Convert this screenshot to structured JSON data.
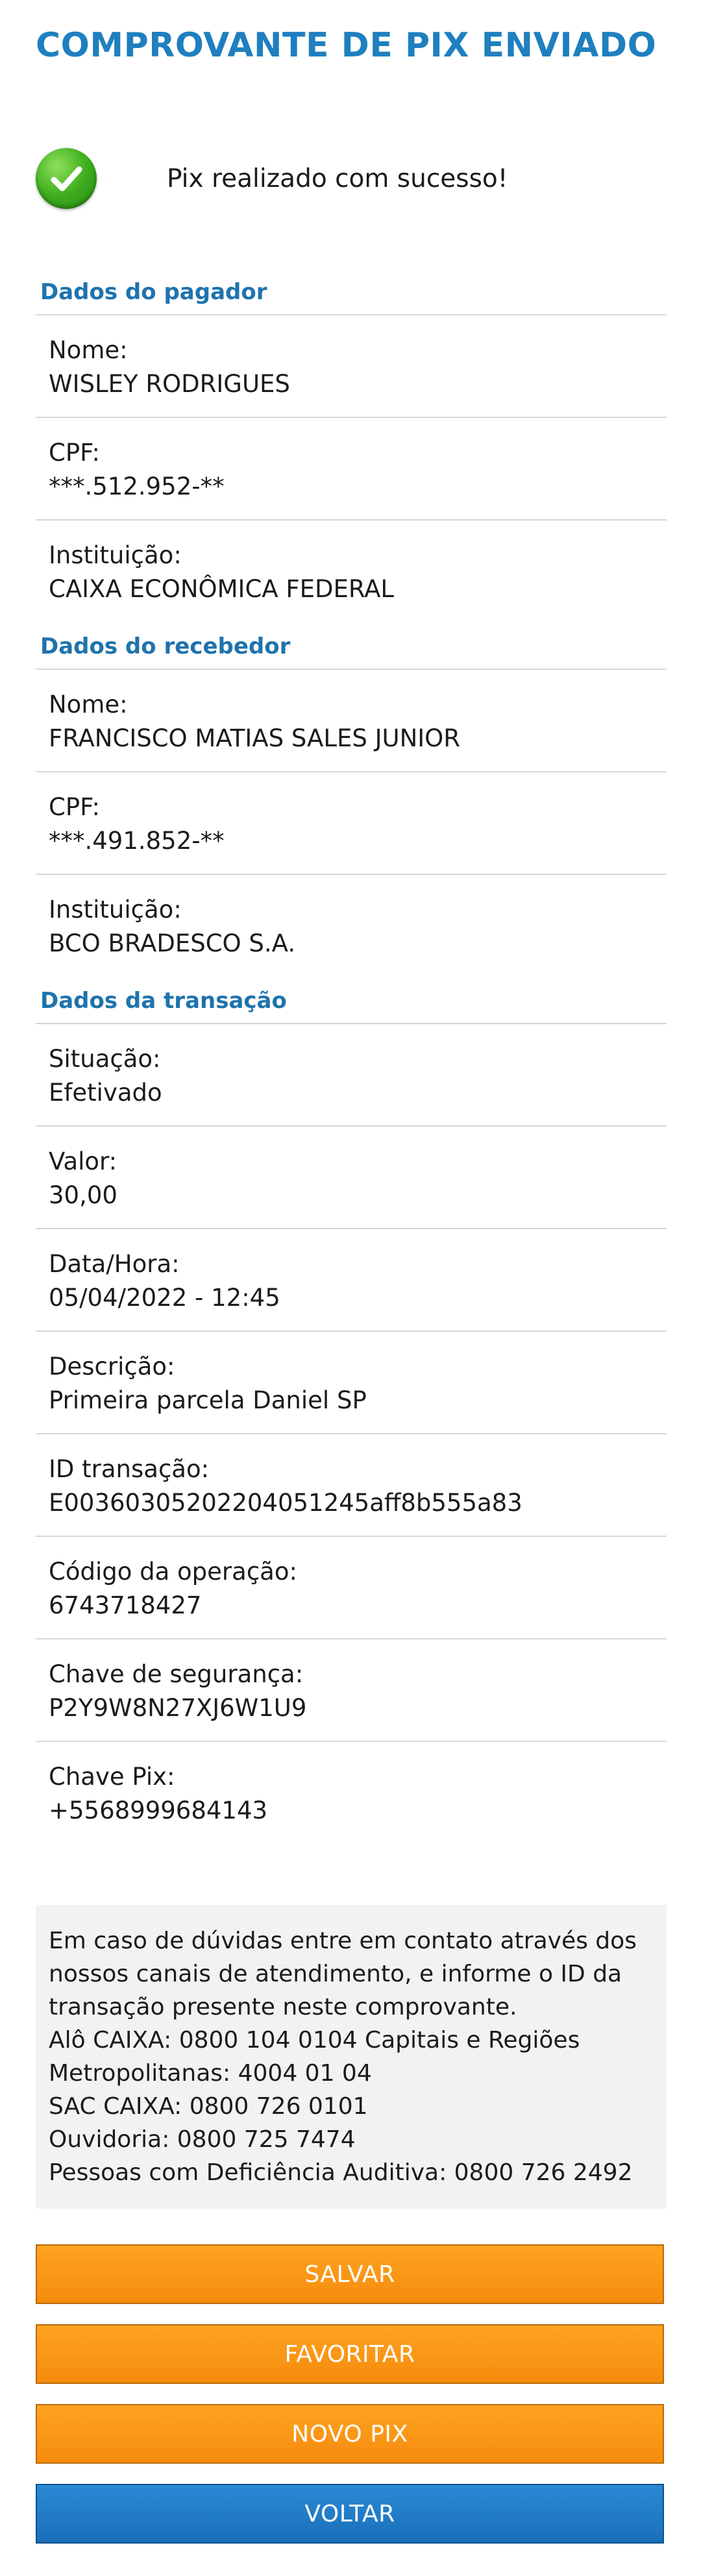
{
  "title": "COMPROVANTE DE PIX ENVIADO",
  "status": {
    "message": "Pix realizado com sucesso!",
    "icon": "check-circle-icon",
    "icon_color": "#3fae1f"
  },
  "accent_color": "#1f7fbf",
  "sections": {
    "pagador": {
      "title": "Dados do pagador",
      "fields": [
        {
          "label": "Nome:",
          "value": "WISLEY RODRIGUES"
        },
        {
          "label": "CPF:",
          "value": "***.512.952-**"
        },
        {
          "label": "Instituição:",
          "value": "CAIXA ECONÔMICA FEDERAL"
        }
      ]
    },
    "recebedor": {
      "title": "Dados do recebedor",
      "fields": [
        {
          "label": "Nome:",
          "value": "FRANCISCO MATIAS SALES JUNIOR"
        },
        {
          "label": "CPF:",
          "value": "***.491.852-**"
        },
        {
          "label": "Instituição:",
          "value": "BCO BRADESCO S.A."
        }
      ]
    },
    "transacao": {
      "title": "Dados da transação",
      "fields": [
        {
          "label": "Situação:",
          "value": "Efetivado"
        },
        {
          "label": "Valor:",
          "value": "30,00"
        },
        {
          "label": "Data/Hora:",
          "value": "05/04/2022 - 12:45"
        },
        {
          "label": "Descrição:",
          "value": "Primeira parcela Daniel SP"
        },
        {
          "label": "ID transação:",
          "value": "E00360305202204051245aff8b555a83"
        },
        {
          "label": "Código da operação:",
          "value": "6743718427"
        },
        {
          "label": "Chave de segurança:",
          "value": "P2Y9W8N27XJ6W1U9"
        },
        {
          "label": "Chave Pix:",
          "value": "+5568999684143"
        }
      ]
    }
  },
  "info": {
    "lines": [
      "Em caso de dúvidas entre em contato através dos",
      "nossos canais de atendimento, e informe o ID da",
      "transação presente neste comprovante.",
      "Alô CAIXA: 0800 104 0104 Capitais e Regiões",
      "Metropolitanas: 4004 01 04",
      "SAC CAIXA: 0800 726 0101",
      "Ouvidoria: 0800 725 7474",
      "Pessoas com Deficiência Auditiva: 0800 726 2492"
    ]
  },
  "buttons": {
    "salvar": "SALVAR",
    "favoritar": "FAVORITAR",
    "novo_pix": "NOVO PIX",
    "voltar": "VOLTAR",
    "orange_color": "#f7931e",
    "blue_color": "#1f7cc8"
  }
}
